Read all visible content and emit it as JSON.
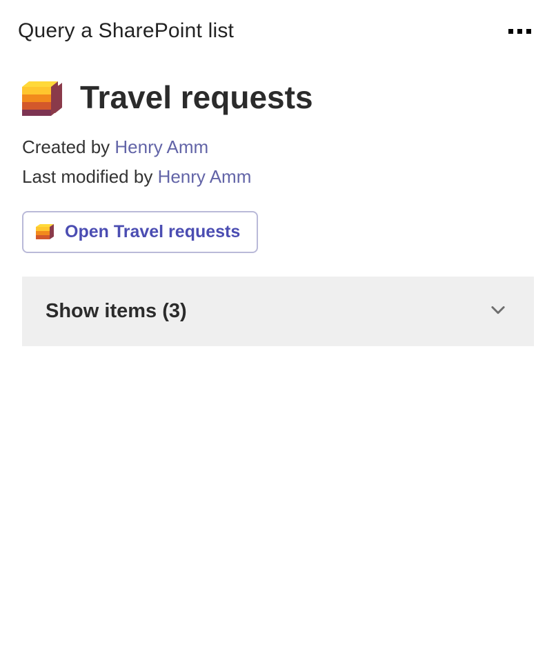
{
  "topbar": {
    "title": "Query a SharePoint list"
  },
  "list": {
    "title": "Travel requests",
    "created_by_label": "Created by ",
    "created_by_name": "Henry Amm",
    "modified_by_label": "Last modified by ",
    "modified_by_name": "Henry Amm",
    "open_button_label": "Open Travel requests"
  },
  "expander": {
    "label": "Show items (3)"
  }
}
